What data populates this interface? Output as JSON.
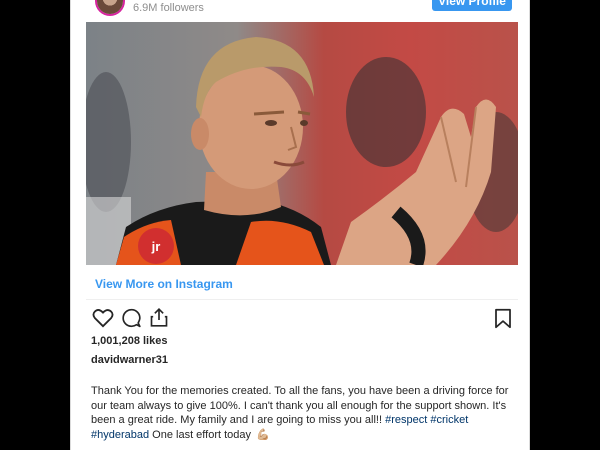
{
  "header": {
    "followers": "6.9M followers",
    "view_profile": "View Profile"
  },
  "photo": {
    "jersey_logo": "jr"
  },
  "view_more": "View More on Instagram",
  "actions": {
    "like_icon": "heart-outline",
    "comment_icon": "comment-bubble",
    "share_icon": "share-upload",
    "save_icon": "bookmark"
  },
  "post": {
    "likes": "1,001,208 likes",
    "username": "davidwarner31",
    "caption_text": "Thank You for the memories created. To all the fans, you have been a driving force for our team always to give 100%. I can't thank you all enough for the support shown. It's been a great ride. My family and I are going to miss you all!! ",
    "hashtag_respect": "#respect",
    "hashtag_cricket": "#cricket",
    "hashtag_hyderabad": "#hyderabad",
    "caption_tail": " One last effort today ",
    "emoji": "💪🏼"
  },
  "colors": {
    "link_blue": "#3897f0",
    "hashtag_blue": "#003569",
    "text_dark": "#262626",
    "muted": "#8e8e8e",
    "jersey_orange": "#e5541b"
  }
}
